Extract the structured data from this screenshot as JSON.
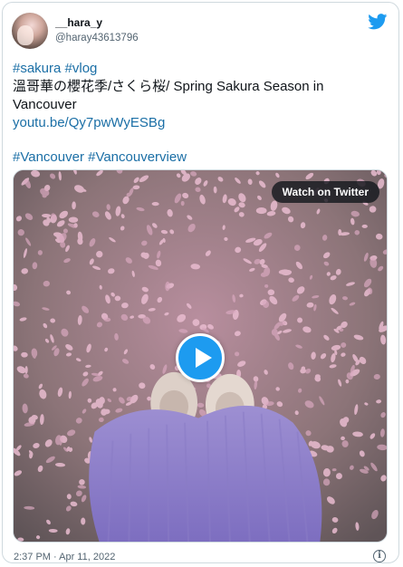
{
  "author": {
    "display_name": "__hara_y",
    "handle": "@haray43613796"
  },
  "tweet": {
    "lines": [
      "#sakura #vlog",
      "溫哥華の櫻花季/さくら桜/ Spring Sakura Season in",
      "Vancouver",
      "youtu.be/Qy7pwWyESBg",
      "",
      "#Vancouver #Vancouverview"
    ]
  },
  "media": {
    "watch_label": "Watch on Twitter"
  },
  "footer": {
    "timestamp": "2:37 PM · Apr 11, 2022"
  },
  "colors": {
    "link": "#1b6fa6",
    "accent": "#1d9bf0",
    "secondary_text": "#536471"
  },
  "icons": [
    "twitter-icon",
    "play-icon",
    "info-icon"
  ]
}
